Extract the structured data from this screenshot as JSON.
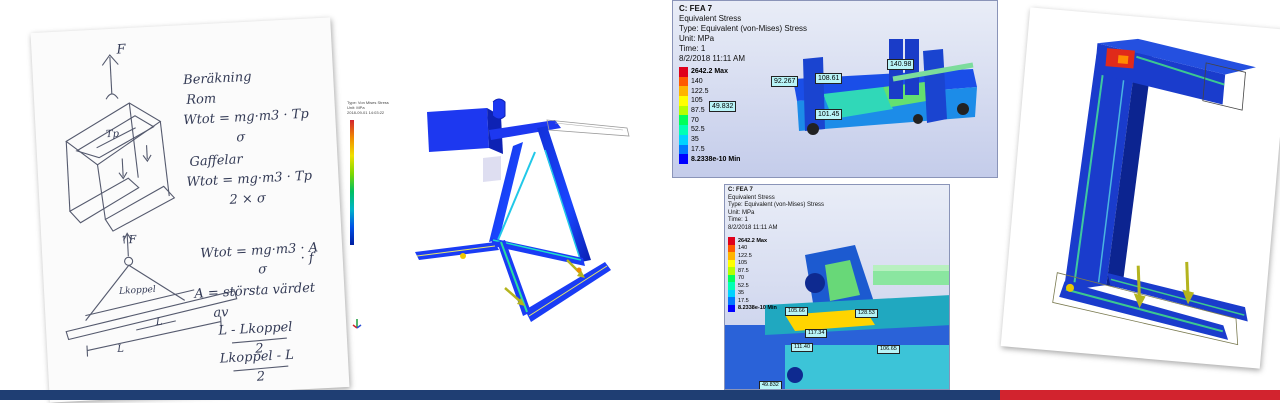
{
  "sketch": {
    "label_force_top": "F",
    "label_force_bottom": "↑F",
    "calc_title": "Beräkning",
    "rom": "Rom",
    "formula_rom": "Wtot = mg·m3 · Tp",
    "den_rom": "σ",
    "gaffel": "Gaffelar",
    "formula_gaffel": "Wtot = mg·m3 · Tp",
    "den_gaffel": "2 × σ",
    "formula_a": "Wtot = mg·m3 · A",
    "den_a": "σ",
    "formula_a_f": "· f",
    "a_def": "A = största värdet",
    "a_av": "av",
    "frac1_num": "L - Lkoppel",
    "frac1_den": "2",
    "frac2_num": "Lkoppel - L",
    "frac2_den": "2",
    "tp": "Tp",
    "lkoppel": "Lkoppel",
    "l_small": "L",
    "l_large": "L"
  },
  "small_legend": {
    "l1": "Type: Von Mises Stress",
    "l2": "Unit: MPa",
    "l3": "2018-09-01 14:03:22"
  },
  "fea_top": {
    "title": "C: FEA 7",
    "l1": "Equivalent Stress",
    "l2": "Type: Equivalent (von-Mises) Stress",
    "l3": "Unit: MPa",
    "l4": "Time: 1",
    "l5": "8/2/2018 11:11 AM",
    "legend": [
      "2642.2 Max",
      "140",
      "122.5",
      "105",
      "87.5",
      "70",
      "52.5",
      "35",
      "17.5",
      "8.2338e-10 Min"
    ],
    "probes": [
      "92.267",
      "108.61",
      "140.98",
      "49.832",
      "101.45"
    ]
  },
  "fea_bottom": {
    "title": "C: FEA 7",
    "l1": "Equivalent Stress",
    "l2": "Type: Equivalent (von-Mises) Stress",
    "l3": "Unit: MPa",
    "l4": "Time: 1",
    "l5": "8/2/2018 11:11 AM",
    "legend": [
      "2642.2 Max",
      "140",
      "122.5",
      "105",
      "87.5",
      "70",
      "52.5",
      "35",
      "17.5",
      "8.2338e-10 Min"
    ],
    "probes": [
      "105.66",
      "128.53",
      "117.34",
      "111.40",
      "106.65",
      "49.832"
    ]
  },
  "colors": {
    "banner_blue": "#1f3e73",
    "banner_red": "#d2232e",
    "legend_scale": [
      "#e0001b",
      "#ff5a00",
      "#ffb400",
      "#ffff00",
      "#b4ff00",
      "#00ff5a",
      "#00ffb4",
      "#00d2ff",
      "#0078ff",
      "#0000ff"
    ]
  }
}
